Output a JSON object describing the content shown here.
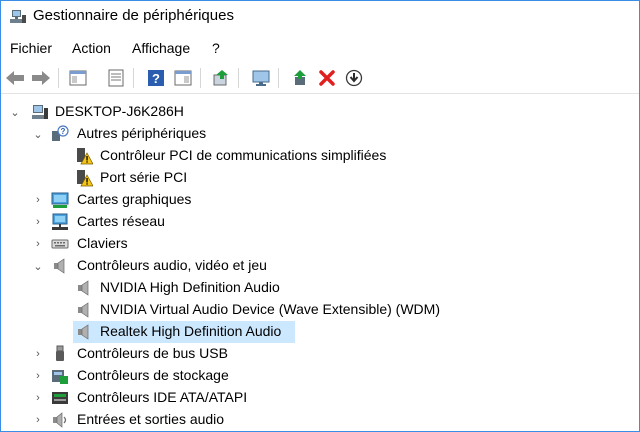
{
  "window": {
    "title": "Gestionnaire de périphériques"
  },
  "menu": [
    "Fichier",
    "Action",
    "Affichage",
    "?"
  ],
  "toolbar": {
    "buttons": [
      "back",
      "forward",
      "show-hide-console-tree",
      "properties",
      "help",
      "action-pane",
      "update-driver",
      "scan-hardware-changes",
      "enable-device",
      "uninstall-device",
      "download-driver"
    ]
  },
  "tree": {
    "root": "DESKTOP-J6K286H",
    "items": [
      {
        "label": "Autres périphériques",
        "expanded": true,
        "icon": "unknown-device-icon"
      },
      {
        "label": "Contrôleur PCI de communications simplifiées",
        "icon": "warning-device-icon"
      },
      {
        "label": "Port série PCI",
        "icon": "warning-device-icon"
      },
      {
        "label": "Cartes graphiques",
        "expanded": false,
        "icon": "display-adapter-icon"
      },
      {
        "label": "Cartes réseau",
        "expanded": false,
        "icon": "network-adapter-icon"
      },
      {
        "label": "Claviers",
        "expanded": false,
        "icon": "keyboard-icon"
      },
      {
        "label": "Contrôleurs audio, vidéo et jeu",
        "expanded": true,
        "icon": "speaker-icon"
      },
      {
        "label": "NVIDIA High Definition Audio",
        "icon": "speaker-icon"
      },
      {
        "label": "NVIDIA Virtual Audio Device (Wave Extensible) (WDM)",
        "icon": "speaker-icon"
      },
      {
        "label": "Realtek High Definition Audio",
        "icon": "speaker-icon",
        "selected": true
      },
      {
        "label": "Contrôleurs de bus USB",
        "expanded": false,
        "icon": "usb-icon"
      },
      {
        "label": "Contrôleurs de stockage",
        "expanded": false,
        "icon": "storage-controller-icon"
      },
      {
        "label": "Contrôleurs IDE ATA/ATAPI",
        "expanded": false,
        "icon": "ide-controller-icon"
      },
      {
        "label": "Entrées et sorties audio",
        "expanded": false,
        "icon": "audio-io-icon"
      }
    ]
  },
  "colors": {
    "selection": "#cce8ff",
    "border": "#3a8ee6",
    "help_blue": "#2a5db0",
    "delete_red": "#e02020",
    "green": "#1e9e3a"
  }
}
